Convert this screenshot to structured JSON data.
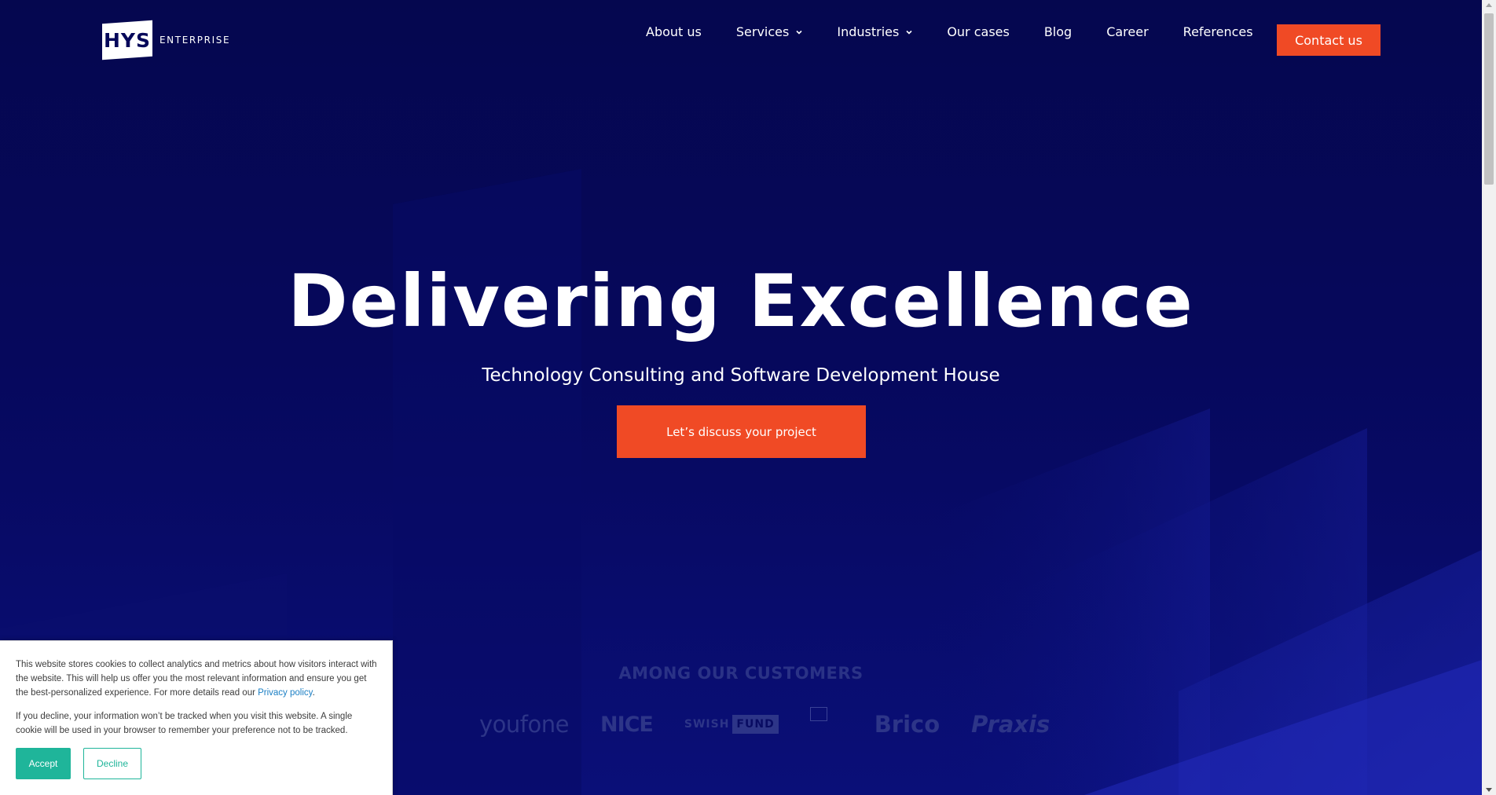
{
  "header": {
    "logo_text": "HYS",
    "logo_sub": "ENTERPRISE",
    "nav": [
      {
        "label": "About us",
        "dropdown": false
      },
      {
        "label": "Services",
        "dropdown": true
      },
      {
        "label": "Industries",
        "dropdown": true
      },
      {
        "label": "Our cases",
        "dropdown": false
      },
      {
        "label": "Blog",
        "dropdown": false
      },
      {
        "label": "Career",
        "dropdown": false
      },
      {
        "label": "References",
        "dropdown": false
      }
    ],
    "contact_label": "Contact us"
  },
  "hero": {
    "title": "Delivering Excellence",
    "subtitle": "Technology Consulting and Software Development House",
    "cta_label": "Let’s discuss your project"
  },
  "customers": {
    "title": "AMONG OUR CUSTOMERS",
    "logos": {
      "youfone": "youfone",
      "nice": "NICE",
      "swish_prefix": "SWISH",
      "swish_suffix": "FUND",
      "brico": "Brico",
      "praxis": "Praxis"
    }
  },
  "cookie": {
    "text1": "This website stores cookies to collect analytics and metrics about how visitors interact with the website. This will help us offer you the most relevant information and ensure you get the best-personalized experience. For more details read our ",
    "privacy_link": "Privacy policy",
    "text1_end": ".",
    "text2": "If you decline, your information won’t be tracked when you visit this website. A single cookie will be used in your browser to remember your preference not to be tracked.",
    "accept_label": "Accept",
    "decline_label": "Decline"
  },
  "colors": {
    "background": "#06085a",
    "accent": "#f04a25",
    "cookie_accent": "#1fb59a",
    "customer_logo": "#2d3588"
  }
}
